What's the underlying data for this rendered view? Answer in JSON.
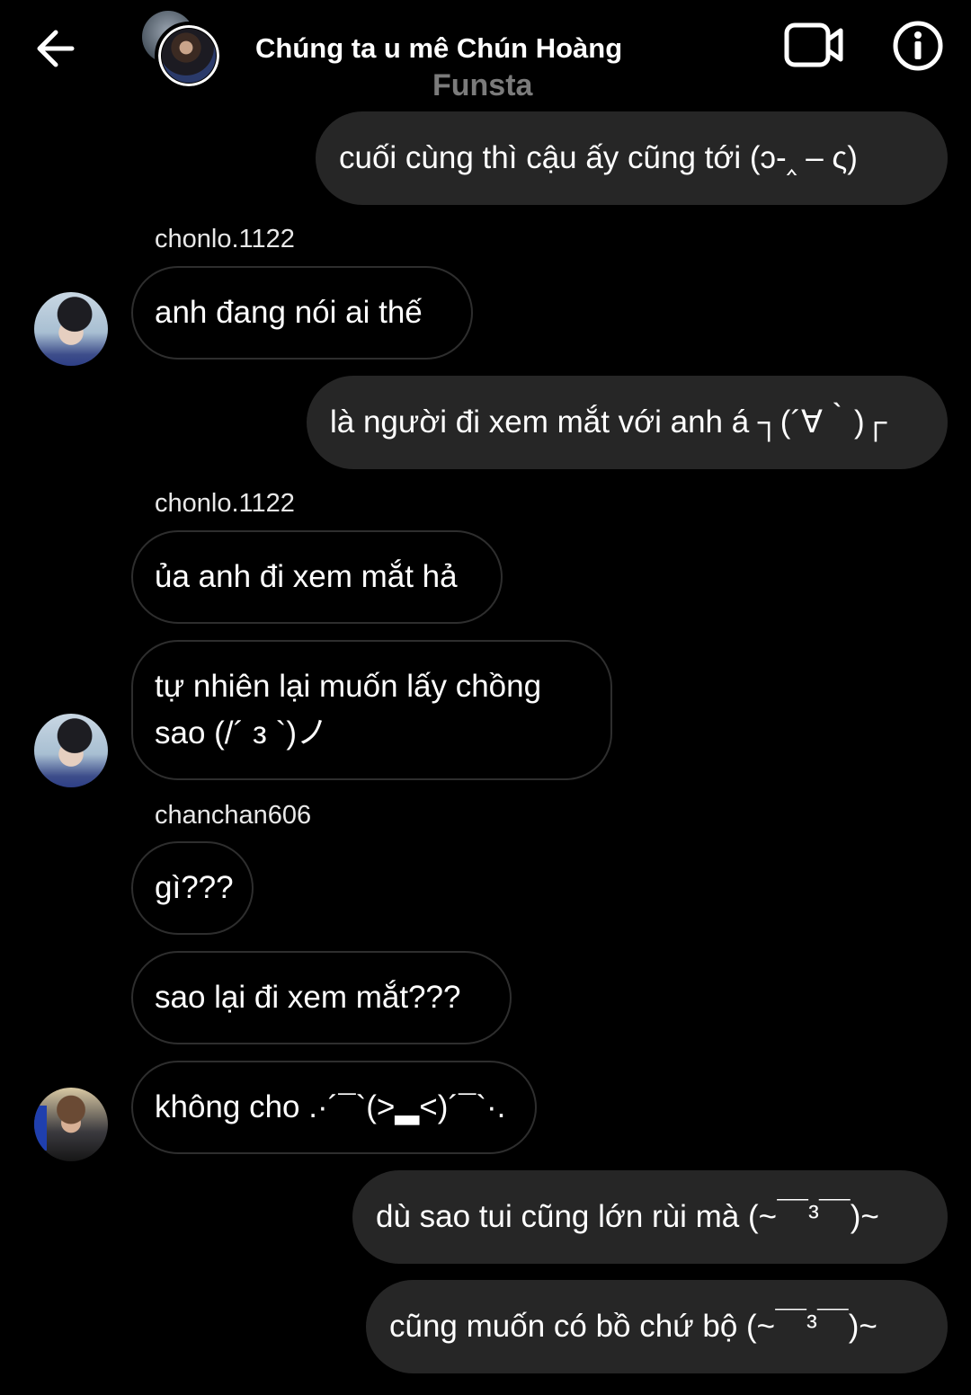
{
  "header": {
    "title": "Chúng ta u mê Chún Hoàng",
    "subtitle": "Funsta"
  },
  "messages": [
    {
      "text": "cuối cùng thì cậu ấy cũng tới (ↄ-‸ – ς)"
    },
    {
      "sender": "chonlo.1122",
      "text": "anh đang nói ai thế"
    },
    {
      "text": "là người đi xem mắt với anh á ┐(´∀｀)┌"
    },
    {
      "sender": "chonlo.1122",
      "text": "ủa anh đi xem mắt hả"
    },
    {
      "text_line1": "tự nhiên lại muốn lấy chồng",
      "text_line2": "sao (/´ з `)ノ"
    },
    {
      "sender": "chanchan606",
      "text": "gì???"
    },
    {
      "text": "sao lại đi xem mắt???"
    },
    {
      "text": "không cho .·´¯`(>▂<)´¯`·."
    },
    {
      "text": "dù sao tui cũng lớn rùi mà (~￣³￣)~"
    },
    {
      "text": "cũng muốn có bồ chứ bộ (~￣³￣)~"
    }
  ],
  "icons": [
    "back-arrow-icon",
    "video-call-icon",
    "info-icon"
  ]
}
